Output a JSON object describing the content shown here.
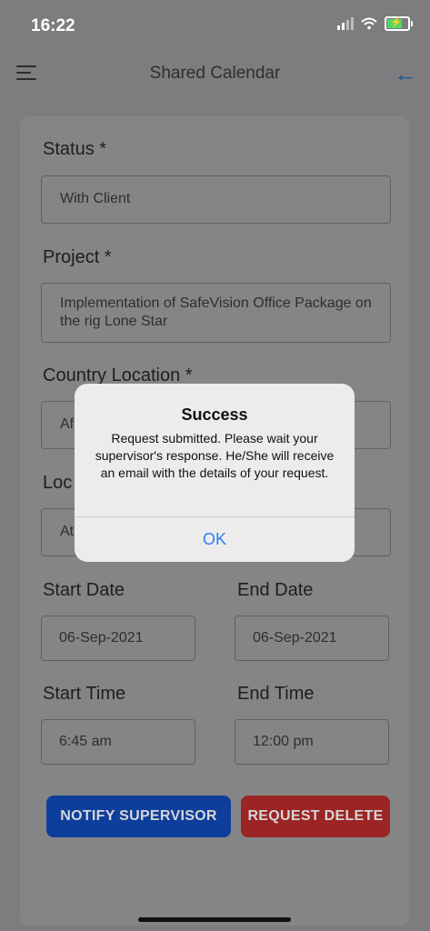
{
  "status_bar": {
    "time": "16:22"
  },
  "header": {
    "title": "Shared Calendar"
  },
  "form": {
    "status": {
      "label": "Status *",
      "value": "With Client"
    },
    "project": {
      "label": "Project *",
      "value": " Implementation of SafeVision Office Package on the rig Lone Star"
    },
    "country": {
      "label": "Country Location *",
      "value_visible": "Af"
    },
    "location": {
      "label_visible": "Loc",
      "value_visible": "At"
    },
    "start_date": {
      "label": "Start Date",
      "value": "06-Sep-2021"
    },
    "end_date": {
      "label": "End Date",
      "value": "06-Sep-2021"
    },
    "start_time": {
      "label": "Start Time",
      "value": "6:45 am"
    },
    "end_time": {
      "label": "End Time",
      "value": "12:00 pm"
    }
  },
  "buttons": {
    "notify": "NOTIFY SUPERVISOR",
    "delete": "REQUEST DELETE"
  },
  "alert": {
    "title": "Success",
    "message": "Request submitted. Please wait your supervisor's response. He/She will receive an email with the details of your request.",
    "ok": "OK"
  },
  "colors": {
    "accent": "#1a4e9c",
    "notify_button": "#0e3e9c",
    "delete_button": "#9b2524",
    "alert_ok": "#2d7ef2"
  }
}
